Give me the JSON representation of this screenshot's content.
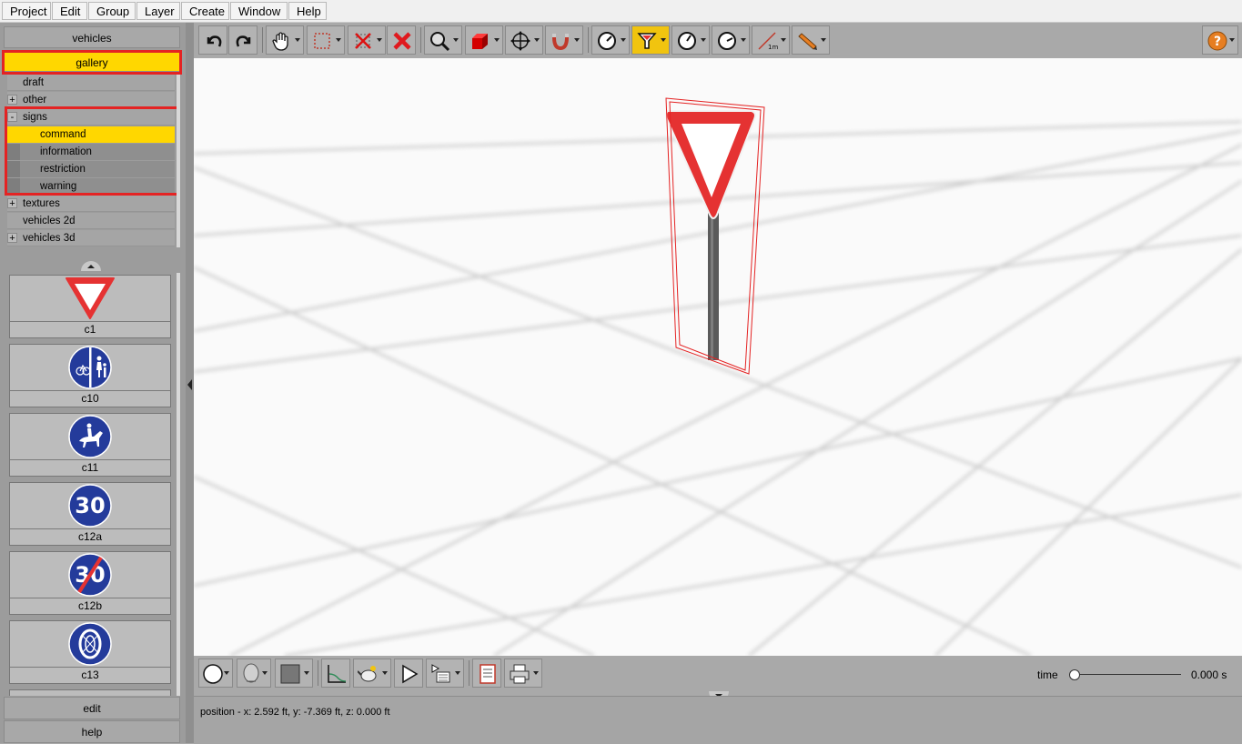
{
  "menubar": {
    "items": [
      "Project",
      "Edit",
      "Group",
      "Layer",
      "Create",
      "Window",
      "Help"
    ]
  },
  "left_panel": {
    "top_button": "vehicles",
    "gallery_button": "gallery",
    "tree": [
      {
        "label": "draft",
        "expander": ""
      },
      {
        "label": "other",
        "expander": "+"
      },
      {
        "label": "signs",
        "expander": "-"
      },
      {
        "label": "command",
        "expander": ""
      },
      {
        "label": "information",
        "expander": ""
      },
      {
        "label": "restriction",
        "expander": ""
      },
      {
        "label": "warning",
        "expander": ""
      },
      {
        "label": "textures",
        "expander": "+"
      },
      {
        "label": "vehicles 2d",
        "expander": ""
      },
      {
        "label": "vehicles 3d",
        "expander": "+"
      }
    ],
    "tiles": [
      {
        "caption": "c1",
        "icon": "yield-sign-icon"
      },
      {
        "caption": "c10",
        "icon": "bicycle-pedestrian-sign-icon"
      },
      {
        "caption": "c11",
        "icon": "horse-rider-sign-icon"
      },
      {
        "caption": "c12a",
        "icon": "minimum-speed-sign-icon",
        "text": "30"
      },
      {
        "caption": "c12b",
        "icon": "end-minimum-speed-sign-icon",
        "text": "30"
      },
      {
        "caption": "c13",
        "icon": "snow-chains-sign-icon"
      }
    ],
    "edit_button": "edit",
    "help_button": "help"
  },
  "toolbar": {
    "buttons": [
      "undo-icon",
      "redo-icon",
      "pan-hand-icon",
      "select-rectangle-icon",
      "delete-selection-icon",
      "delete-icon",
      "zoom-icon",
      "3d-box-icon",
      "move-icon",
      "magnet-icon",
      "measure-gauge-icon",
      "filter-icon",
      "gauge-icon",
      "gauge-alt-icon",
      "ruler-1m-icon",
      "pencil-icon",
      "help-icon"
    ],
    "ruler_label": "1m"
  },
  "bottom_bar": {
    "time_label": "time",
    "time_value": "0.000 s",
    "time_fraction": 0
  },
  "status": {
    "text": "position - x: 2.592 ft, y: -7.369 ft, z: 0.000 ft"
  },
  "colors": {
    "selection": "#ffd700",
    "highlight_outline": "#e42323",
    "sign_red": "#e53232",
    "sign_blue": "#243b9b"
  }
}
